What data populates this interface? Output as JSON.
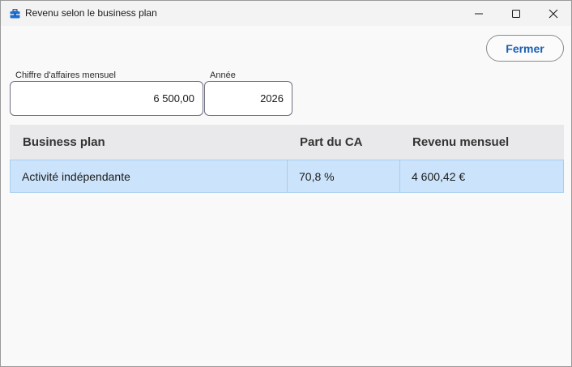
{
  "window": {
    "title": "Revenu selon le business plan",
    "icon": "toolbox-icon",
    "controls": [
      "minimize-icon",
      "maximize-icon",
      "close-icon"
    ]
  },
  "toolbar": {
    "close_label": "Fermer"
  },
  "fields": {
    "ca_label": "Chiffre d'affaires mensuel",
    "ca_value": "6 500,00",
    "annee_label": "Année",
    "annee_value": "2026"
  },
  "table": {
    "headers": [
      "Business plan",
      "Part du CA",
      "Revenu mensuel"
    ],
    "rows": [
      [
        "Activité indépendante",
        "70,8 %",
        "4 600,42 €"
      ]
    ]
  },
  "colors": {
    "accent": "#1a5fb4",
    "selected_row": "#cce4fb",
    "header_bg": "#e9e9eb"
  }
}
